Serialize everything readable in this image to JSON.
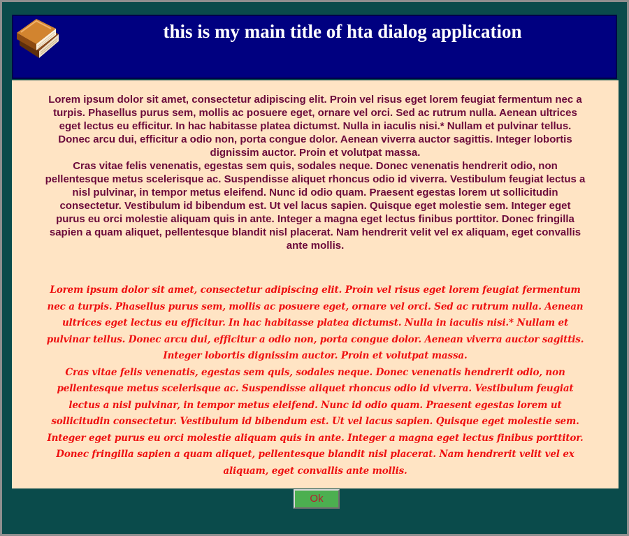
{
  "window": {
    "title": "this is my main title of hta dialog application",
    "icon": "books-icon"
  },
  "content": {
    "paragraph_bold": "Lorem ipsum dolor sit amet, consectetur adipiscing elit. Proin vel risus eget lorem feugiat fermentum nec a turpis. Phasellus purus sem, mollis ac posuere eget, ornare vel orci. Sed ac rutrum nulla. Aenean ultrices eget lectus eu efficitur. In hac habitasse platea dictumst. Nulla in iaculis nisi.* Nullam et pulvinar tellus. Donec arcu dui, efficitur a odio non, porta congue dolor. Aenean viverra auctor sagittis. Integer lobortis dignissim auctor. Proin et volutpat massa.\nCras vitae felis venenatis, egestas sem quis, sodales neque. Donec venenatis hendrerit odio, non pellentesque metus scelerisque ac. Suspendisse aliquet rhoncus odio id viverra. Vestibulum feugiat lectus a nisl pulvinar, in tempor metus eleifend. Nunc id odio quam. Praesent egestas lorem ut sollicitudin consectetur. Vestibulum id bibendum est. Ut vel lacus sapien. Quisque eget molestie sem. Integer eget purus eu orci molestie aliquam quis in ante. Integer a magna eget lectus finibus porttitor. Donec fringilla sapien a quam aliquet, pellentesque blandit nisl placerat. Nam hendrerit velit vel ex aliquam, eget convallis ante mollis.",
    "paragraph_script": "Lorem ipsum dolor sit amet, consectetur adipiscing elit. Proin vel risus eget lorem feugiat fermentum nec a turpis. Phasellus purus sem, mollis ac posuere eget, ornare vel orci. Sed ac rutrum nulla. Aenean ultrices eget lectus eu efficitur. In hac habitasse platea dictumst. Nulla in iaculis nisi.* Nullam et pulvinar tellus. Donec arcu dui, efficitur a odio non, porta congue dolor. Aenean viverra auctor sagittis. Integer lobortis dignissim auctor. Proin et volutpat massa.\nCras vitae felis venenatis, egestas sem quis, sodales neque. Donec venenatis hendrerit odio, non pellentesque metus scelerisque ac. Suspendisse aliquet rhoncus odio id viverra. Vestibulum feugiat lectus a nisl pulvinar, in tempor metus eleifend. Nunc id odio quam. Praesent egestas lorem ut sollicitudin consectetur. Vestibulum id bibendum est. Ut vel lacus sapien. Quisque eget molestie sem. Integer eget purus eu orci molestie aliquam quis in ante. Integer a magna eget lectus finibus porttitor. Donec fringilla sapien a quam aliquet, pellentesque blandit nisl placerat. Nam hendrerit velit vel ex aliquam, eget convallis ante mollis."
  },
  "footer": {
    "ok_label": "Ok"
  },
  "colors": {
    "frame": "#0a4b4b",
    "header": "#000080",
    "content_background": "#ffe4c4",
    "bold_text": "#6b0a3b",
    "script_text": "#ee1111",
    "ok_button": "#4caf50"
  }
}
